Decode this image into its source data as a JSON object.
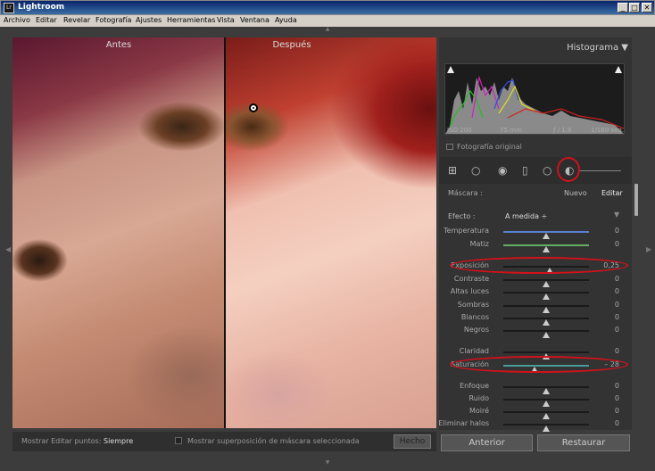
{
  "window": {
    "title": "Lightroom",
    "logo_text": "Lr",
    "minimize": "_",
    "maximize": "□",
    "close": "✕"
  },
  "menu": [
    "Archivo",
    "Editar",
    "Revelar",
    "Fotografía",
    "Ajustes",
    "Herramientas",
    "Vista",
    "Ventana",
    "Ayuda"
  ],
  "photo": {
    "before_label": "Antes",
    "after_label": "Después"
  },
  "toolbar": {
    "show_pins_label": "Mostrar Editar puntos:",
    "show_pins_value": "Siempre",
    "overlay_label": "Mostrar superposición de máscara seleccionada",
    "done_label": "Hecho"
  },
  "histogram": {
    "title": "Histograma",
    "iso": "ISO 200",
    "focal": "75 mm",
    "aperture": "ƒ / 1,8",
    "shutter": "1/160 seg.",
    "original_label": "Fotografía original"
  },
  "mask": {
    "label": "Máscara :",
    "new_label": "Nuevo",
    "edit_label": "Editar"
  },
  "effect": {
    "label": "Efecto :",
    "value": "A medida ÷"
  },
  "sliders": [
    {
      "name": "Temperatura",
      "value": "0",
      "pos": 0.5,
      "color": "#5a7fd0"
    },
    {
      "name": "Matiz",
      "value": "0",
      "pos": 0.5,
      "color": "#60b060"
    },
    {
      "name": "Exposición",
      "value": "0,25",
      "pos": 0.54,
      "color": "#1a1a1a",
      "highlighted": true
    },
    {
      "name": "Contraste",
      "value": "0",
      "pos": 0.5,
      "color": "#1a1a1a"
    },
    {
      "name": "Altas luces",
      "value": "0",
      "pos": 0.5,
      "color": "#1a1a1a"
    },
    {
      "name": "Sombras",
      "value": "0",
      "pos": 0.5,
      "color": "#1a1a1a"
    },
    {
      "name": "Blancos",
      "value": "0",
      "pos": 0.5,
      "color": "#1a1a1a"
    },
    {
      "name": "Negros",
      "value": "0",
      "pos": 0.5,
      "color": "#1a1a1a"
    },
    {
      "name": "Claridad",
      "value": "0",
      "pos": 0.5,
      "color": "#1a1a1a"
    },
    {
      "name": "Saturación",
      "value": "– 28",
      "pos": 0.36,
      "color": "#4a9a9a",
      "highlighted": true
    },
    {
      "name": "Enfoque",
      "value": "0",
      "pos": 0.5,
      "color": "#1a1a1a"
    },
    {
      "name": "Ruido",
      "value": "0",
      "pos": 0.5,
      "color": "#1a1a1a"
    },
    {
      "name": "Moiré",
      "value": "0",
      "pos": 0.5,
      "color": "#1a1a1a"
    },
    {
      "name": "Eliminar halos",
      "value": "0",
      "pos": 0.5,
      "color": "#1a1a1a"
    }
  ],
  "buttons": {
    "previous": "Anterior",
    "reset": "Restaurar"
  },
  "colors": {
    "highlight_ring": "#d2121a",
    "panel_bg": "#333333"
  }
}
